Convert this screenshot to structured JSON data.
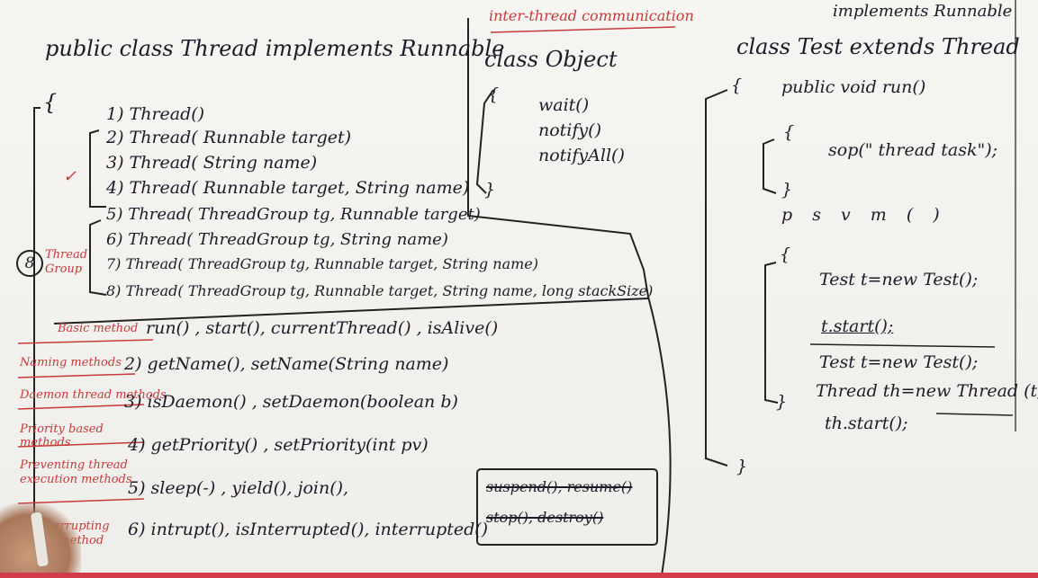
{
  "left": {
    "class_decl": "public class Thread implements Runnable",
    "open_brace": "{",
    "ctor_1": "1) Thread()",
    "ctor_2": "2) Thread( Runnable target)",
    "ctor_3": "3) Thread( String name)",
    "ctor_4": "4) Thread( Runnable target, String name)",
    "ctor_5": "5) Thread( ThreadGroup tg, Runnable target)",
    "ctor_6": "6) Thread( ThreadGroup tg, String name)",
    "ctor_7": "7) Thread( ThreadGroup tg, Runnable target, String name)",
    "ctor_8": "8) Thread( ThreadGroup tg, Runnable target, String name, long stackSize)",
    "circle_8": "8",
    "thread_group_label": "Thread Group",
    "check_mark": "✓"
  },
  "methods": {
    "cat_1": "Basic method",
    "row_1": "run() , start(), currentThread() , isAlive()",
    "cat_2": "Naming methods",
    "row_2": "2) getName(), setName(String name)",
    "cat_3": "Daemon thread methods",
    "row_3": "3) isDaemon() , setDaemon(boolean b)",
    "cat_4": "Priority based methods",
    "row_4": "4) getPriority() , setPriority(int pv)",
    "cat_5": "Preventing thread execution methods",
    "row_5": "5) sleep(-) , yield(), join(),",
    "deprecated_1": "suspend(), resume()",
    "deprecated_2": "stop(), destroy()",
    "cat_6": "Interrupting the method",
    "row_6a": "6) intrupt(), isInterrupted(), interrupted()"
  },
  "middle": {
    "heading": "inter-thread communication",
    "class_decl": "class Object",
    "open_brace": "{",
    "m1": "wait()",
    "m2": "notify()",
    "m3": "notifyAll()",
    "close_brace": "}"
  },
  "right": {
    "implements_note": "implements Runnable",
    "class_decl": "class Test extends Thread",
    "open_brace": "{",
    "run_decl": "public void run()",
    "run_open": "{",
    "sop": "sop(\" thread task\");",
    "run_close": "}",
    "psvm": "p s v m (   )",
    "main_open": "{",
    "l1": "Test t=new Test();",
    "l2": "t.start();",
    "l3": "Test t=new Test();",
    "l4": "Thread th=new Thread (t);",
    "l5": "th.start();",
    "main_close": "}",
    "class_close": "}"
  }
}
